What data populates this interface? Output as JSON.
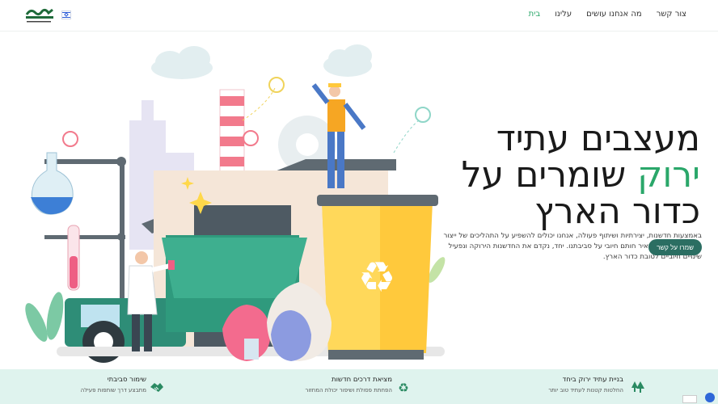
{
  "header": {
    "nav": [
      {
        "label": "בית",
        "active": true
      },
      {
        "label": "עלינו",
        "active": false
      },
      {
        "label": "מה אנחנו עושים",
        "active": false
      },
      {
        "label": "צור קשר",
        "active": false
      }
    ]
  },
  "hero": {
    "title_line1": "מעצבים עתיד",
    "title_green": "ירוק",
    "title_line2_rest": " שומרים על",
    "title_line3": "כדור הארץ",
    "description": "באמצעות חדשנות, יצירתיות ושיתוף פעולה, אנחנו יכולים להשפיע על התהליכים של ייצור ומיחזור באופן שישאיר חותם חיובי על סביבתנו. יחד, נקדם את החדשנות הירוקה ונפעיל שינויים חיוביים לטובת כדור הארץ.",
    "cta_label": "שמרו על קשר"
  },
  "features": [
    {
      "title": "בניית עתיד ירוק ביחד",
      "subtitle": "החלטות קטנות לעתיד טוב יותר",
      "icon": "trees-icon"
    },
    {
      "title": "מציאת דרכים חדשות",
      "subtitle": "הפחתת פסולת ושיפור יכולת המחזור",
      "icon": "recycle-icon"
    },
    {
      "title": "שימור סביבתי",
      "subtitle": "מתבצע דרך שותפות פעילה",
      "icon": "handshake-icon"
    }
  ],
  "colors": {
    "accent": "#2aa76a",
    "cta": "#2b6e62",
    "feature_bar": "#dff3ee"
  }
}
